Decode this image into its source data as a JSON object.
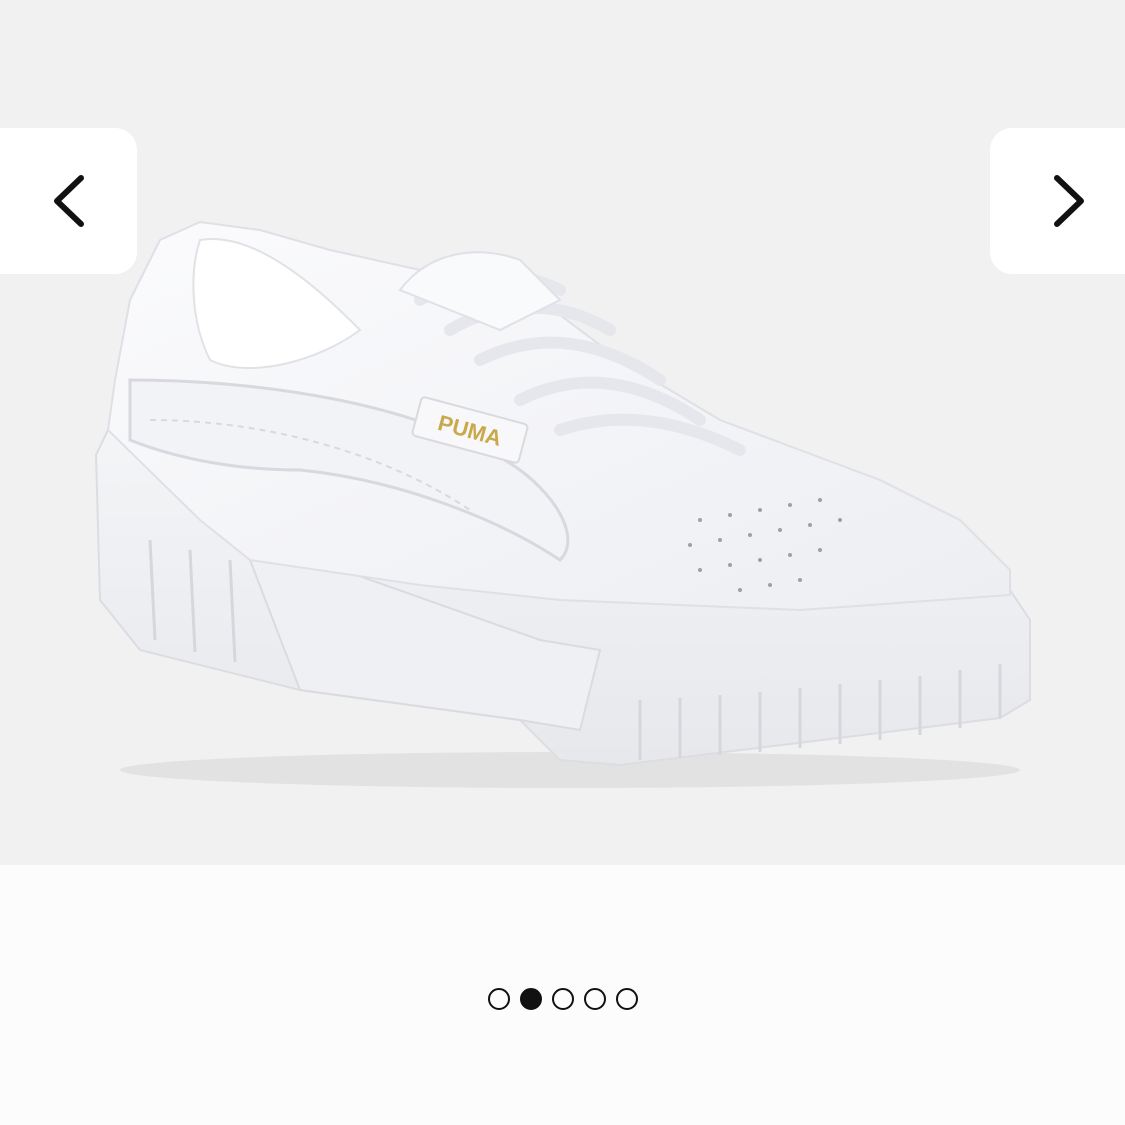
{
  "gallery": {
    "image": {
      "icon": "sneaker-image",
      "brand_mark": "PUMA",
      "background_color": "#f1f1f1",
      "shoe_color": "#f7f8fa",
      "logo_color": "#c9a94a"
    },
    "prev_button": {
      "icon": "chevron-left-icon"
    },
    "next_button": {
      "icon": "chevron-right-icon"
    },
    "pagination": {
      "total": 5,
      "active_index": 1
    }
  }
}
